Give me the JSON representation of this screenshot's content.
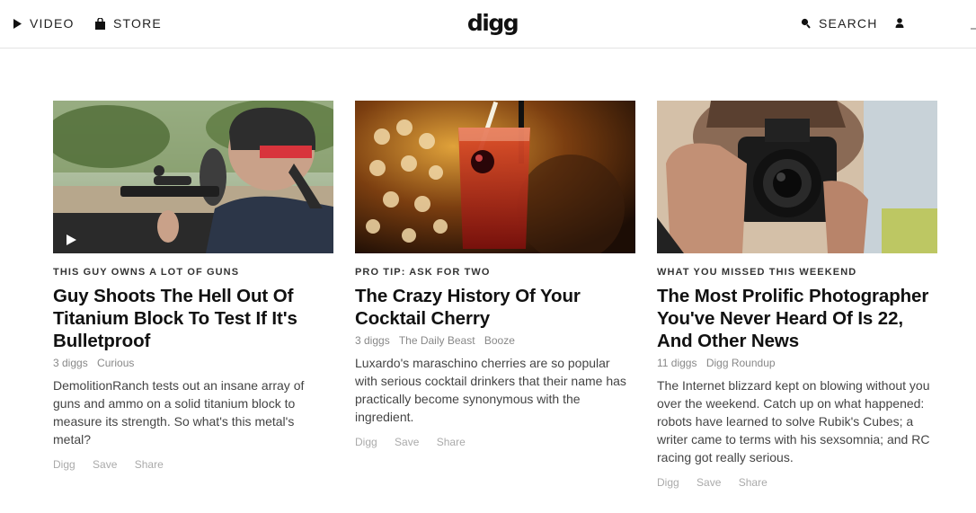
{
  "header": {
    "nav": [
      {
        "label": "VIDEO",
        "icon": "play-icon"
      },
      {
        "label": "STORE",
        "icon": "bag-icon"
      }
    ],
    "logo": "digg",
    "search_label": "SEARCH",
    "search_icon": "search-icon",
    "user_icon": "user-icon"
  },
  "cards": [
    {
      "kicker": "THIS GUY OWNS A LOT OF GUNS",
      "title": "Guy Shoots The Hell Out Of Titanium Block To Test If It's Bulletproof",
      "diggs": "3 diggs",
      "source": "Curious",
      "description": "DemolitionRanch tests out an insane array of guns and ammo on a solid titanium block to measure its strength. So what's this metal's metal?",
      "actions": {
        "digg": "Digg",
        "save": "Save",
        "share": "Share"
      },
      "video": true
    },
    {
      "kicker": "PRO TIP: ASK FOR TWO",
      "title": "The Crazy History Of Your Cocktail Cherry",
      "diggs": "3 diggs",
      "source": "The Daily Beast",
      "tag": "Booze",
      "description": "Luxardo's maraschino cherries are so popular with serious cocktail drinkers that their name has practically become synonymous with the ingredient.",
      "actions": {
        "digg": "Digg",
        "save": "Save",
        "share": "Share"
      }
    },
    {
      "kicker": "WHAT YOU MISSED THIS WEEKEND",
      "title": "The Most Prolific Photographer You've Never Heard Of Is 22, And Other News",
      "diggs": "11 diggs",
      "source": "Digg Roundup",
      "description": "The Internet blizzard kept on blowing without you over the weekend. Catch up on what happened: robots have learned to solve Rubik's Cubes; a writer came to terms with his sexsomnia; and RC racing got really serious.",
      "actions": {
        "digg": "Digg",
        "save": "Save",
        "share": "Share"
      }
    }
  ],
  "colors": {
    "text": "#111111",
    "meta": "#888888",
    "actions": "#aaaaaa",
    "divider": "#e3e3e3"
  }
}
